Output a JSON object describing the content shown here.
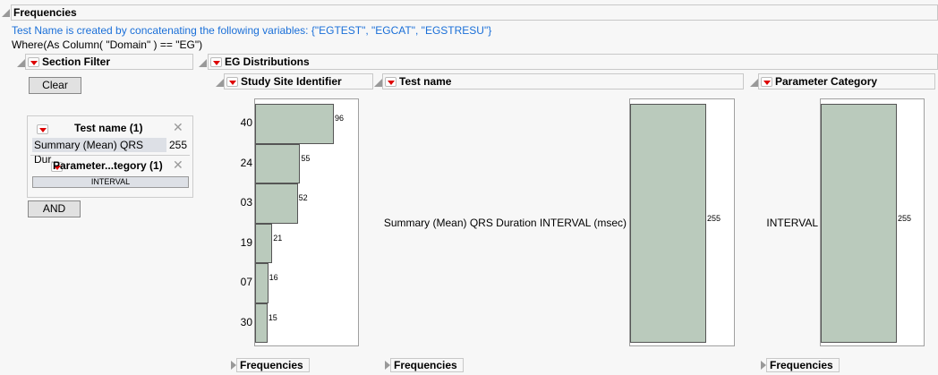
{
  "title": "Frequencies",
  "note": "Test Name is created by concatenating the following variables: {\"EGTEST\", \"EGCAT\", \"EGSTRESU\"}",
  "where": "Where(As Column( \"Domain\" ) == \"EG\")",
  "section_filter": {
    "title": "Section Filter",
    "clear": "Clear",
    "and": "AND",
    "filters": [
      {
        "title": "Test name (1)",
        "value": "Summary (Mean) QRS Dur...",
        "count": "255"
      },
      {
        "title": "Parameter...tegory (1)",
        "value": "INTERVAL"
      }
    ]
  },
  "distributions": {
    "title": "EG Distributions",
    "footer": "Frequencies"
  },
  "colors": {
    "bar": "#bacabc",
    "link": "#1a6fd8"
  },
  "chart_data": [
    {
      "type": "bar",
      "title": "Study Site Identifier",
      "categories": [
        "40",
        "24",
        "03",
        "19",
        "07",
        "30"
      ],
      "values": [
        96,
        55,
        52,
        21,
        16,
        15
      ],
      "orientation": "horizontal"
    },
    {
      "type": "bar",
      "title": "Test name",
      "categories": [
        "Summary (Mean) QRS Duration INTERVAL (msec)"
      ],
      "values": [
        255
      ],
      "orientation": "horizontal"
    },
    {
      "type": "bar",
      "title": "Parameter Category",
      "categories": [
        "INTERVAL"
      ],
      "values": [
        255
      ],
      "orientation": "horizontal"
    }
  ]
}
